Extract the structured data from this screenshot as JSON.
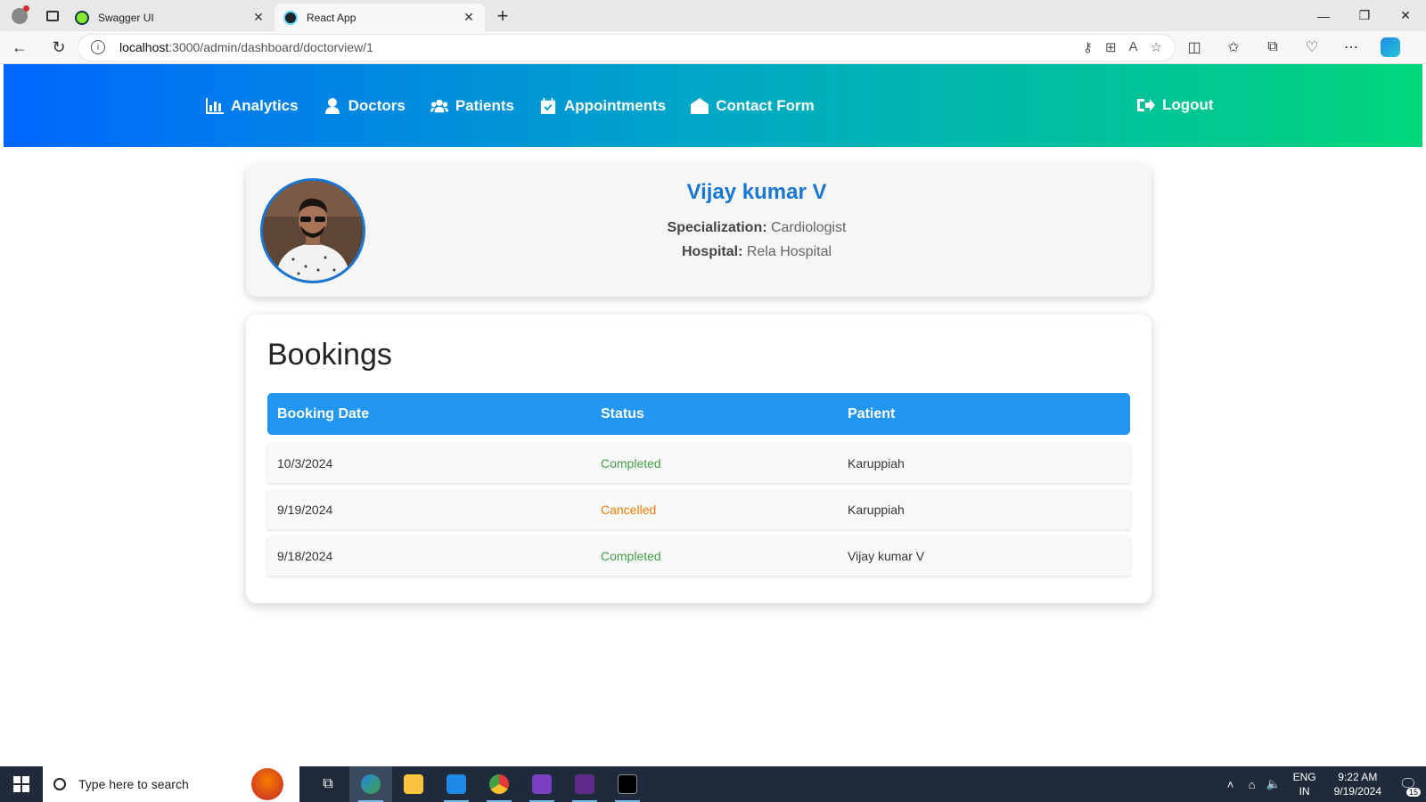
{
  "browser": {
    "tabs": [
      {
        "label": "Swagger UI",
        "active": false
      },
      {
        "label": "React App",
        "active": true
      }
    ],
    "url_host": "localhost",
    "url_path": ":3000/admin/dashboard/doctorview/1"
  },
  "navbar": {
    "items": [
      {
        "label": "Analytics",
        "icon": "chart-bar-icon"
      },
      {
        "label": "Doctors",
        "icon": "user-doctor-icon"
      },
      {
        "label": "Patients",
        "icon": "users-icon"
      },
      {
        "label": "Appointments",
        "icon": "calendar-check-icon"
      },
      {
        "label": "Contact Form",
        "icon": "envelope-open-icon"
      }
    ],
    "logout_label": "Logout",
    "gradient": [
      "#0066ff",
      "#00d67a"
    ]
  },
  "doctor": {
    "name": "Vijay kumar V",
    "specialization_label": "Specialization:",
    "specialization": "Cardiologist",
    "hospital_label": "Hospital:",
    "hospital": "Rela Hospital"
  },
  "bookings": {
    "title": "Bookings",
    "columns": [
      "Booking Date",
      "Status",
      "Patient"
    ],
    "rows": [
      {
        "date": "10/3/2024",
        "status": "Completed",
        "patient": "Karuppiah"
      },
      {
        "date": "9/19/2024",
        "status": "Cancelled",
        "patient": "Karuppiah"
      },
      {
        "date": "9/18/2024",
        "status": "Completed",
        "patient": "Vijay kumar V"
      }
    ],
    "status_colors": {
      "Completed": "#43a047",
      "Cancelled": "#f57c00"
    }
  },
  "taskbar": {
    "search_placeholder": "Type here to search",
    "lang_top": "ENG",
    "lang_bottom": "IN",
    "time": "9:22 AM",
    "date": "9/19/2024",
    "notifications": "15"
  }
}
